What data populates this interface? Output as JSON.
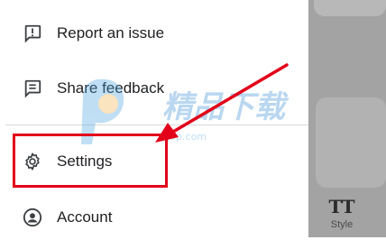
{
  "menu": {
    "items": [
      {
        "label": "Report an issue",
        "icon": "report-issue-icon"
      },
      {
        "label": "Share feedback",
        "icon": "feedback-icon"
      },
      {
        "label": "Settings",
        "icon": "gear-icon"
      },
      {
        "label": "Account",
        "icon": "account-icon"
      }
    ]
  },
  "side_panel": {
    "style_label": "Style",
    "style_icon_text": "TT"
  },
  "watermark": {
    "title": "精品下载",
    "url": "j9p.com"
  },
  "colors": {
    "highlight": "#e2001a",
    "panel": "#a3a3a3",
    "text": "#202124"
  }
}
